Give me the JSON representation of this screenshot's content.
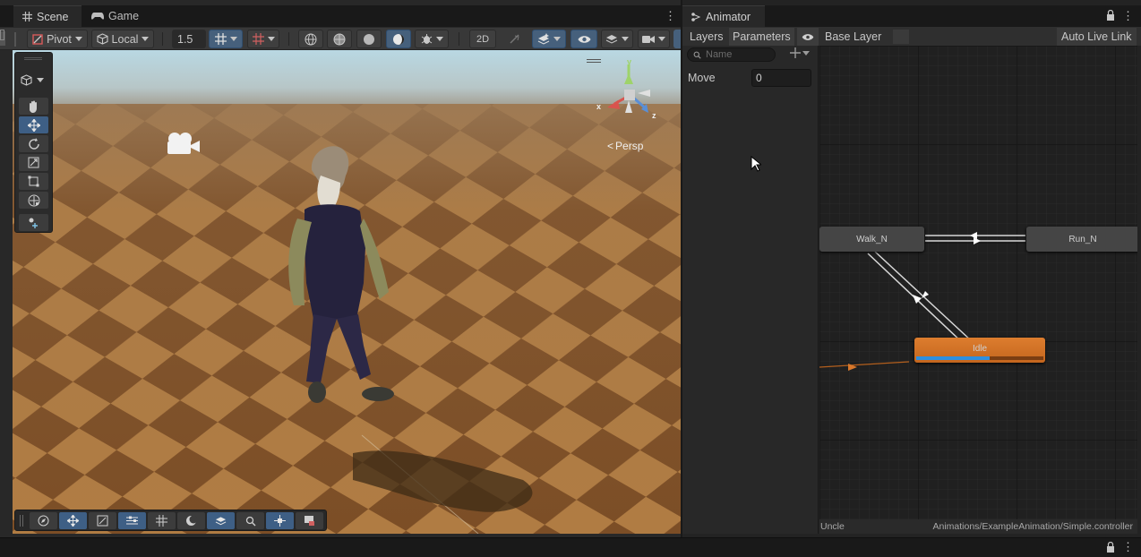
{
  "scene_window": {
    "tabs": [
      {
        "label": "Scene",
        "icon": "grid-icon",
        "active": true
      },
      {
        "label": "Game",
        "icon": "gamepad-icon",
        "active": false
      }
    ],
    "toolbar": {
      "pivot_label": "Pivot",
      "space_label": "Local",
      "snap_value": "1.5",
      "toggle_2d_label": "2D"
    },
    "view": {
      "projection_label": "Persp",
      "gizmo_axes": {
        "y": "y",
        "z": "z",
        "x": "x"
      }
    }
  },
  "animator_window": {
    "tab_label": "Animator",
    "header": {
      "layers_tab": "Layers",
      "parameters_tab": "Parameters",
      "breadcrumb": "Base Layer",
      "auto_live_link": "Auto Live Link"
    },
    "parameters": {
      "search_placeholder": "Name",
      "items": [
        {
          "name": "Move",
          "value": "0"
        }
      ]
    },
    "states": [
      {
        "name": "Walk_N",
        "kind": "normal"
      },
      {
        "name": "Run_N",
        "kind": "normal"
      },
      {
        "name": "Idle",
        "kind": "default",
        "progress": 0.58
      }
    ],
    "status": {
      "object": "Uncle",
      "controller_path": "Animations/ExampleAnimation/Simple.controller"
    }
  },
  "colors": {
    "accent": "#46607c",
    "default_state": "#d9782b",
    "progress": "#2d8fe0",
    "ground_dark": "#7e5226",
    "ground_light": "#b08048"
  }
}
